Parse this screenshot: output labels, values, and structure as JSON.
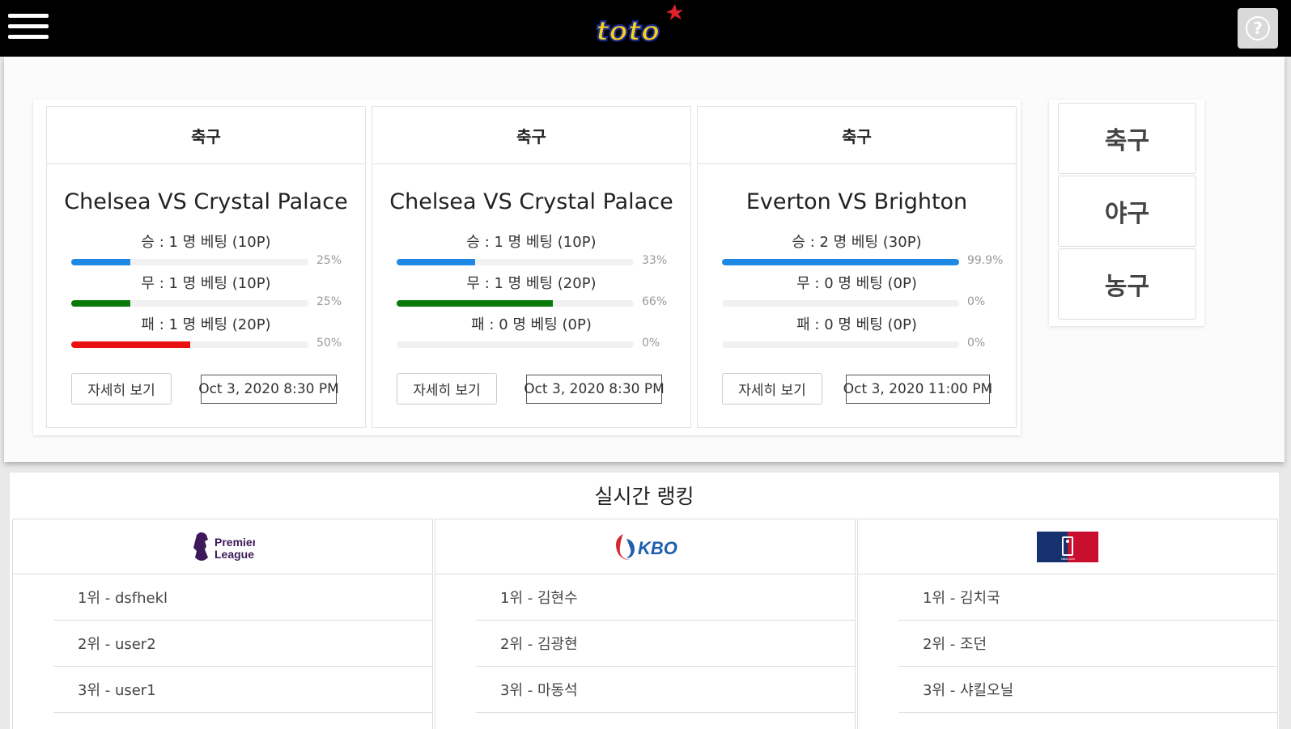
{
  "header": {
    "logo_text": "toto",
    "help_symbol": "?",
    "menu_icon": "hamburger-icon",
    "help_icon": "question-icon"
  },
  "games": [
    {
      "sport": "축구",
      "title": "Chelsea VS Crystal Palace",
      "bets": [
        {
          "label": "승 : 1 명 베팅 (10P)",
          "percent_text": "25%",
          "percent": 25,
          "color": "#1e88e5"
        },
        {
          "label": "무 : 1 명 베팅 (10P)",
          "percent_text": "25%",
          "percent": 25,
          "color": "#0b7a0b"
        },
        {
          "label": "패 : 1 명 베팅 (20P)",
          "percent_text": "50%",
          "percent": 50,
          "color": "#e81010"
        }
      ],
      "detail_label": "자세히 보기",
      "date": "Oct 3, 2020 8:30 PM"
    },
    {
      "sport": "축구",
      "title": "Chelsea VS Crystal Palace",
      "bets": [
        {
          "label": "승 : 1 명 베팅 (10P)",
          "percent_text": "33%",
          "percent": 33,
          "color": "#1e88e5"
        },
        {
          "label": "무 : 1 명 베팅 (20P)",
          "percent_text": "66%",
          "percent": 66,
          "color": "#0b7a0b"
        },
        {
          "label": "패 : 0 명 베팅 (0P)",
          "percent_text": "0%",
          "percent": 0,
          "color": "#e81010"
        }
      ],
      "detail_label": "자세히 보기",
      "date": "Oct 3, 2020 8:30 PM"
    },
    {
      "sport": "축구",
      "title": "Everton VS Brighton",
      "bets": [
        {
          "label": "승 : 2 명 베팅 (30P)",
          "percent_text": "99.9%",
          "percent": 99.9,
          "color": "#1e88e5"
        },
        {
          "label": "무 : 0 명 베팅 (0P)",
          "percent_text": "0%",
          "percent": 0,
          "color": "#0b7a0b"
        },
        {
          "label": "패 : 0 명 베팅 (0P)",
          "percent_text": "0%",
          "percent": 0,
          "color": "#e81010"
        }
      ],
      "detail_label": "자세히 보기",
      "date": "Oct 3, 2020 11:00 PM"
    }
  ],
  "sports_menu": [
    "축구",
    "야구",
    "농구"
  ],
  "ranking": {
    "title": "실시간 랭킹",
    "leagues": [
      {
        "logo": "premier-league-logo",
        "logo_text": [
          "Premier",
          "League"
        ],
        "rows": [
          "1위 - dsfhekl",
          "2위 - user2",
          "3위 - user1"
        ]
      },
      {
        "logo": "kbo-logo",
        "logo_text": [
          "KBO"
        ],
        "rows": [
          "1위 - 김현수",
          "2위 - 김광현",
          "3위 - 마동석"
        ]
      },
      {
        "logo": "nba-logo",
        "logo_text": [
          "NBA.com"
        ],
        "rows": [
          "1위 - 김치국",
          "2위 - 조던",
          "3위 - 샤킬오닐"
        ]
      }
    ]
  }
}
